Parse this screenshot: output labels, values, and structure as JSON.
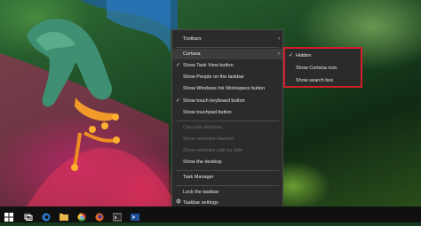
{
  "context_menu": {
    "toolbars": "Toolbars",
    "cortana": "Cortana",
    "show_task_view": "Show Task View button",
    "show_people": "Show People on the taskbar",
    "show_ink_workspace": "Show Windows Ink Workspace button",
    "show_touch_keyboard": "Show touch keyboard button",
    "show_touchpad": "Show touchpad button",
    "cascade_windows": "Cascade windows",
    "show_windows_stacked": "Show windows stacked",
    "show_windows_side_by_side": "Show windows side by side",
    "show_desktop": "Show the desktop",
    "task_manager": "Task Manager",
    "lock_taskbar": "Lock the taskbar",
    "taskbar_settings": "Taskbar settings"
  },
  "cortana_submenu": {
    "hidden": "Hidden",
    "show_cortana_icon": "Show Cortana icon",
    "show_search_box": "Show search box"
  },
  "glyphs": {
    "check": "✓",
    "arrow": "›"
  },
  "colors": {
    "highlight_border": "#d2202a",
    "menu_bg": "#2b2b2b"
  }
}
